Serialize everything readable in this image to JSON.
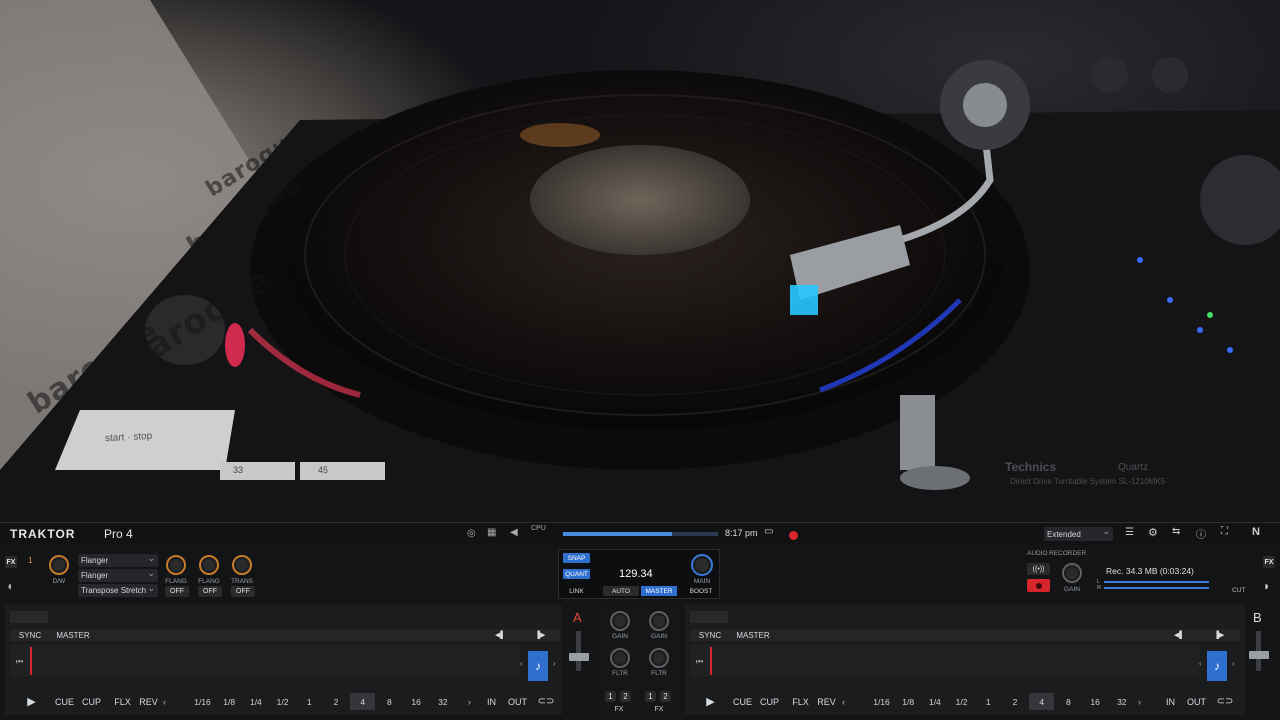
{
  "photo": {
    "poster_text": [
      "baroque",
      "baroque",
      "baroque",
      "barogue"
    ],
    "turntable": {
      "start_stop": "start · stop",
      "speed_33": "33",
      "speed_45": "45",
      "brand": "Technics",
      "brand_suffix": "Quartz",
      "model_line": "Direct Drive Turntable System SL-1210MK5"
    }
  },
  "header": {
    "logo": "TRAKTOR",
    "logo_suffix": "Pro 4",
    "cpu_label": "CPU",
    "cpu_level": 0.7,
    "clock": "8:17 pm",
    "layout_select": "Extended"
  },
  "fx": {
    "unit_label": "FX",
    "unit_num": "1",
    "dw_label": "D/W",
    "slots": [
      "Flanger",
      "Flanger",
      "Transpose Stretch"
    ],
    "knob_labels": [
      "FLANG",
      "FLANG",
      "TRANS"
    ],
    "buttons": [
      "OFF",
      "OFF",
      "OFF"
    ]
  },
  "master": {
    "snap": "SNAP",
    "quant": "QUANT",
    "tempo": "129.34",
    "link": "LINK",
    "auto": "AUTO",
    "master": "MASTER",
    "main": "MAIN",
    "boost": "BOOST"
  },
  "recorder": {
    "audio_label": "AUDIO",
    "recorder_label": "RECORDER",
    "gain": "GAIN",
    "status": "Rec. 34.3 MB (0:03:24)",
    "ch_l": "L",
    "ch_r": "R",
    "cut": "CUT",
    "fx_label": "FX"
  },
  "deck_a": {
    "letter": "A",
    "sync": "SYNC",
    "master": "MASTER",
    "cue": "CUE",
    "cup": "CUP",
    "flx": "FLX",
    "rev": "REV",
    "loops": [
      "1/16",
      "1/8",
      "1/4",
      "1/2",
      "1",
      "2",
      "4",
      "8",
      "16",
      "32"
    ],
    "loop_active": "4",
    "in": "IN",
    "out": "OUT"
  },
  "deck_b": {
    "letter": "B",
    "sync": "SYNC",
    "master": "MASTER",
    "cue": "CUE",
    "cup": "CUP",
    "flx": "FLX",
    "rev": "REV",
    "loops": [
      "1/16",
      "1/8",
      "1/4",
      "1/2",
      "1",
      "2",
      "4",
      "8",
      "16",
      "32"
    ],
    "loop_active": "4",
    "in": "IN",
    "out": "OUT"
  },
  "mixer": {
    "gain": "GAIN",
    "fltr": "FLTR",
    "fx": "FX",
    "fx_assign": [
      "1",
      "2"
    ]
  },
  "colors": {
    "accent_blue": "#2f6fd0",
    "record_red": "#d6262b",
    "deck_letter": "#e8483b"
  }
}
